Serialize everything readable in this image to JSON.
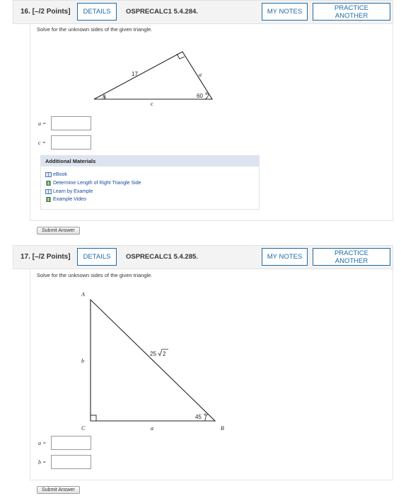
{
  "q16": {
    "title": "16. [–/2 Points]",
    "details_label": "DETAILS",
    "code": "OSPRECALC1 5.4.284.",
    "my_notes_label": "MY NOTES",
    "practice_label": "PRACTICE ANOTHER",
    "prompt": "Solve for the unknown sides of the given triangle.",
    "triangle": {
      "hyp": "17",
      "side_a": "a",
      "angle_A": "A",
      "side_c": "c",
      "angle": "60"
    },
    "answers": [
      {
        "label": "a =",
        "value": ""
      },
      {
        "label": "c =",
        "value": ""
      }
    ],
    "materials": {
      "heading": "Additional Materials",
      "items": [
        {
          "label": "eBook",
          "icon": "book-icon"
        },
        {
          "label": "Determine Length of Right Triangle Side",
          "icon": "film-icon"
        },
        {
          "label": "Learn by Example",
          "icon": "book-icon"
        },
        {
          "label": "Example Video",
          "icon": "film-icon"
        }
      ]
    },
    "submit_label": "Submit Answer"
  },
  "q17": {
    "title": "17. [–/2 Points]",
    "details_label": "DETAILS",
    "code": "OSPRECALC1 5.4.285.",
    "my_notes_label": "MY NOTES",
    "practice_label": "PRACTICE ANOTHER",
    "prompt": "Solve for the unknown sides of the given triangle.",
    "triangle": {
      "vertex_A": "A",
      "vertex_B": "B",
      "vertex_C": "C",
      "side_b": "b",
      "side_a": "a",
      "hyp_coef": "25",
      "hyp_rad": "2",
      "angle": "45"
    },
    "answers": [
      {
        "label": "a =",
        "value": ""
      },
      {
        "label": "b =",
        "value": ""
      }
    ],
    "submit_label": "Submit Answer"
  },
  "colors": {
    "accent": "#1f6aa5",
    "header_bg": "#f3f3f3",
    "materials_head": "#dde4f0",
    "link": "#1a48a0"
  }
}
